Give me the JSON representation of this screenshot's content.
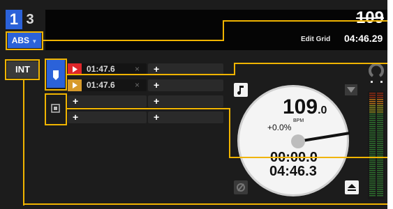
{
  "deck": {
    "deck_numbers": [
      "1",
      "3"
    ],
    "bpm_header": "109",
    "edit_grid_label": "Edit Grid",
    "total_time": "04:46.29",
    "abs_label": "ABS",
    "abs_arrow": "▼",
    "int_label": "INT"
  },
  "cues": [
    {
      "color": "#e0262a",
      "time": "01:47.6",
      "remove": "×",
      "add": "+"
    },
    {
      "color": "#d79a2a",
      "time": "01:47.6",
      "remove": "×",
      "add": "+"
    },
    {
      "add_left": "+",
      "add_right": "+"
    },
    {
      "add_left": "+",
      "add_right": "+"
    }
  ],
  "platter": {
    "bpm_value": "109",
    "bpm_decimal": ".0",
    "bpm_unit": "BPM",
    "pitch": "+0.0%",
    "elapsed": "00:00.0",
    "remaining": "04:46.3"
  },
  "icons": {
    "music_note": "music-note-icon",
    "sync": "sync-icon",
    "eject": "eject-icon",
    "hotcue": "hotcue-icon",
    "loop": "loop-icon",
    "play": "play-icon"
  },
  "colors": {
    "accent": "#f0b400",
    "deck_blue": "#2b62d9",
    "deck_bg": "#1c1c1c"
  }
}
